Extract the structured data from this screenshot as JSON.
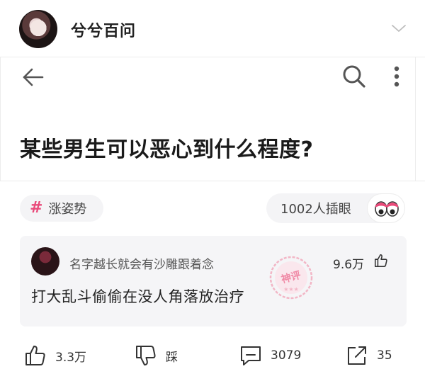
{
  "header": {
    "account_name": "兮兮百问"
  },
  "question": {
    "title": "某些男生可以恶心到什么程度?"
  },
  "topic": {
    "hash": "#",
    "label": "涨姿势"
  },
  "reaction": {
    "label": "1002人插眼"
  },
  "comment": {
    "author": "名字越长就会有沙雕跟着念",
    "likes": "9.6万",
    "text": "打大乱斗偷偷在没人角落放治疗",
    "stamp": "神评"
  },
  "actions": {
    "like_count": "3.3万",
    "dislike_label": "踩",
    "comment_count": "3079",
    "share_count": "35"
  },
  "colors": {
    "accent": "#e94a7a",
    "stamp": "#f2b6c6"
  }
}
